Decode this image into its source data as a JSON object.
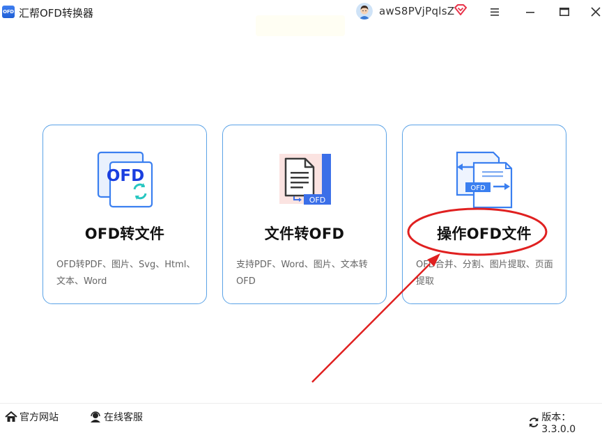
{
  "app": {
    "logo_text": "OFD",
    "title": "汇帮OFD转换器",
    "username": "awS8PVjPqlsZ"
  },
  "cards": [
    {
      "title": "OFD转文件",
      "description": "OFD转PDF、图片、Svg、Html、文本、Word",
      "icon": "ofd-convert-icon",
      "icon_text": "OFD"
    },
    {
      "title": "文件转OFD",
      "description": "支持PDF、Word、图片、文本转OFD",
      "icon": "document-to-ofd-icon",
      "icon_text": "OFD"
    },
    {
      "title": "操作OFD文件",
      "description": "OFD合并、分割、图片提取、页面提取",
      "icon": "ofd-operate-icon",
      "icon_text": "OFD"
    }
  ],
  "footer": {
    "website": "官方网站",
    "service": "在线客服",
    "version": "版本：3.3.0.0"
  },
  "colors": {
    "accent": "#1f5fd6",
    "card_border": "#5aa2e6",
    "annotation": "#e02020"
  }
}
